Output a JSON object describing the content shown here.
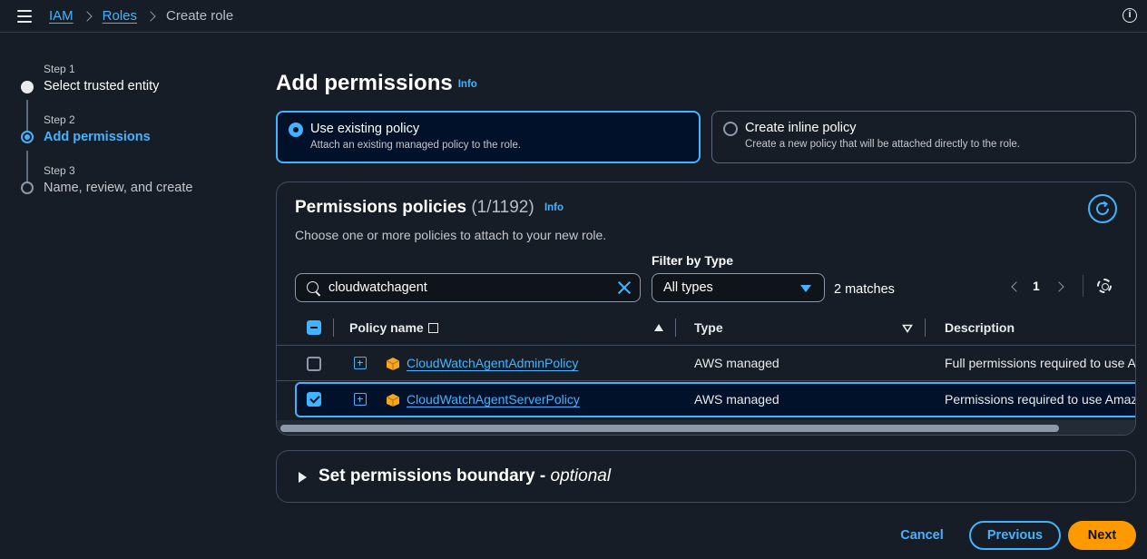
{
  "breadcrumb": {
    "items": [
      "IAM",
      "Roles"
    ],
    "current": "Create role"
  },
  "steps": [
    {
      "label": "Step 1",
      "title": "Select trusted entity",
      "state": "done"
    },
    {
      "label": "Step 2",
      "title": "Add permissions",
      "state": "active"
    },
    {
      "label": "Step 3",
      "title": "Name, review, and create",
      "state": "future"
    }
  ],
  "page": {
    "title": "Add permissions",
    "info": "Info"
  },
  "options": [
    {
      "title": "Use existing policy",
      "desc": "Attach an existing managed policy to the role.",
      "selected": true
    },
    {
      "title": "Create inline policy",
      "desc": "Create a new policy that will be attached directly to the role.",
      "selected": false
    }
  ],
  "policies": {
    "title": "Permissions policies",
    "count": "(1/1192)",
    "info": "Info",
    "description": "Choose one or more policies to attach to your new role.",
    "filter_label": "Filter by Type",
    "search_value": "cloudwatchagent",
    "filter_value": "All types",
    "matches": "2 matches",
    "page": "1",
    "columns": [
      "Policy name",
      "Type",
      "Description"
    ],
    "rows": [
      {
        "name": "CloudWatchAgentAdminPolicy",
        "type": "AWS managed",
        "description": "Full permissions required to use A",
        "checked": false
      },
      {
        "name": "CloudWatchAgentServerPolicy",
        "type": "AWS managed",
        "description": "Permissions required to use Amaz",
        "checked": true
      }
    ]
  },
  "boundary": {
    "title": "Set permissions boundary -",
    "optional": "optional"
  },
  "actions": {
    "cancel": "Cancel",
    "previous": "Previous",
    "next": "Next"
  },
  "colors": {
    "accent": "#42b4ff",
    "primary_button": "#ff9900",
    "background": "#161d26"
  }
}
